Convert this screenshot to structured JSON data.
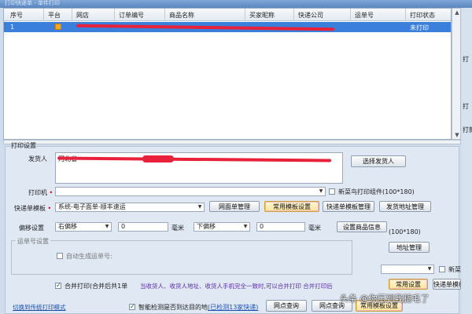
{
  "window": {
    "title": "打印快递单 - 单件打印"
  },
  "grid": {
    "columns": [
      "序号",
      "平台",
      "网店",
      "订单编号",
      "商品名称",
      "买家昵称",
      "快递公司",
      "运单号",
      "打印状态"
    ],
    "row": {
      "index": "1",
      "status": "未打印"
    }
  },
  "right_strip": {
    "item1": "打",
    "item2": "打",
    "item3": "打款人"
  },
  "print": {
    "section": "打印设置",
    "sender_label": "发货人",
    "sender_text": "河北省",
    "select_sender": "选择发货人",
    "printer_label": "打印机",
    "printer_value": "",
    "new_rookie": "新菜鸟打印组件(100*180)",
    "template_label": "快递单模板",
    "template_value": "系统-电子面单-顺丰速运",
    "btn_eface": "网面单管理",
    "btn_common_template": "常用模板设置",
    "btn_template_mgr": "快递单模板管理",
    "btn_sender_addr": "发货地址管理",
    "offset_label": "偏移设置",
    "offset_h_dir": "右偏移",
    "offset_h_val": "0",
    "offset_v_dir": "下偏移",
    "offset_v_val": "0",
    "unit": "毫米",
    "btn_goods_info": "设置商品信息",
    "size_note": "(100*180)",
    "waybill_label": "运单号设置",
    "auto_gen": "自动生成运单号:",
    "btn_address_mgr": "地址管理",
    "merge_print": "合并打印(合并后共1单",
    "merge_hint": "当收货人、收货人地址、收货人手机完全一致时,可以合并打印 合并打印后",
    "right_select": "",
    "new_rookie_2": "新菜",
    "btn_common_set2": "常用设置",
    "btn_template_mgr2": "快递单模板管理"
  },
  "footer": {
    "link_mode": "切换到传统打印模式",
    "smart_check": "智能检测是否到达目的地",
    "smart_link": "(已检测13家快递)",
    "btn_outlet_query": "网点查询",
    "btn_outlet_query2": "网点查询",
    "btn_common_template3": "常用模板设置"
  },
  "watermark": "头条 @你压到我腿毛了"
}
